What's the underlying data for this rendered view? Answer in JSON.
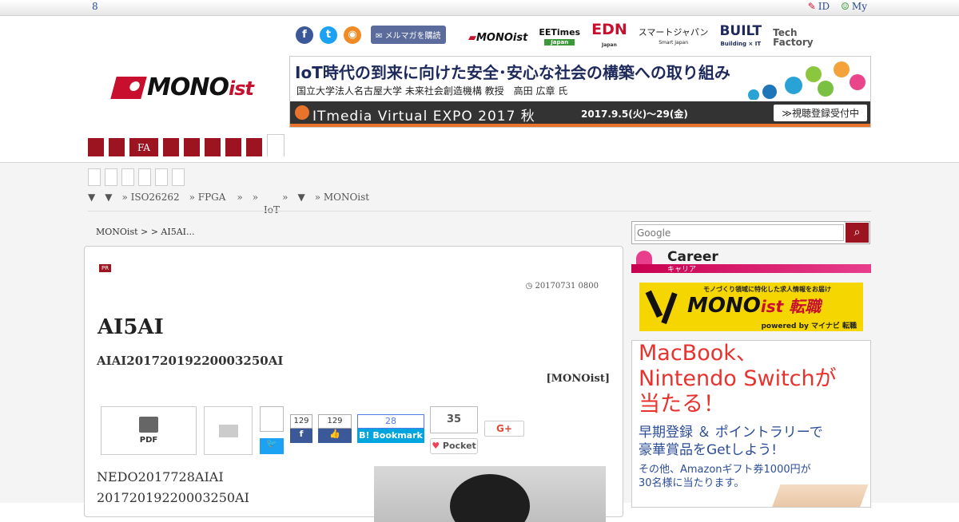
{
  "topbar": {
    "number": "8",
    "id_label": "ID",
    "my_label": "My"
  },
  "header": {
    "tagline": "",
    "mail_button": "メルマガを購読",
    "brands": [
      "MONOist",
      "EETimes",
      "EDN",
      "スマートジャパン",
      "BUILT",
      "Tech Factory"
    ],
    "brands_sub": [
      "",
      "Japan",
      "Japan",
      "Smart Japan",
      "Building × IT",
      ""
    ],
    "logo_main": "MONO",
    "logo_suffix": "ist"
  },
  "banner": {
    "line1": "IoT時代の到来に向けた安全･安心な社会の構築への取り組み",
    "line2": "国立大学法人名古屋大学 未来社会創造機構 教授　高田 広章 氏",
    "expo": "ITmedia Virtual EXPO 2017 秋",
    "dates": "2017.9.5(火)〜29(金)",
    "cta": "≫視聴登録受付中"
  },
  "nav": {
    "tabs": [
      "",
      "",
      "FA",
      "",
      "",
      "",
      "",
      ""
    ]
  },
  "subnav": {
    "links": [
      "▼",
      "▼",
      "» ISO26262",
      "» FPGA",
      "»",
      "»",
      "»",
      "▼",
      "» MONOist"
    ],
    "iot": "IoT"
  },
  "breadcrumb": "MONOist >  > AI5AI...",
  "article": {
    "pr_label": "PR",
    "date": "20170731 0800",
    "title": "AI5AI",
    "lead": "AIAI20172019220003250AI",
    "source": "[MONOist]",
    "pdf_label": "PDF",
    "fb_count": "129",
    "like_count": "129",
    "hatena_count": "28",
    "hatena_label": "Bookmark",
    "pocket_count": "35",
    "pocket_label": "Pocket",
    "gplus_label": "G+",
    "body_lines": [
      "NEDO2017728AIAI",
      "20172019220003250AI"
    ]
  },
  "sidebar": {
    "search_placeholder": "Google",
    "career_title": "Career",
    "career_sub": "キャリア",
    "job_small": "モノづくり領域に特化した求人情報をお届け",
    "job_main": "MONO",
    "job_suffix": "ist 転職",
    "job_powered": "powered by マイナビ 転職",
    "promo_head": [
      "MacBook、",
      "Nintendo Switchが",
      "当たる！"
    ],
    "promo_sub": [
      "早期登録 ＆ ポイントラリーで",
      "豪華賞品をGetしよう!"
    ],
    "promo_small": [
      "その他、Amazonギフト券1000円が",
      "30名様に当たります。"
    ]
  },
  "colors": {
    "accent": "#9c1420",
    "link": "#2b4a8f",
    "promo_red": "#e8322d"
  }
}
